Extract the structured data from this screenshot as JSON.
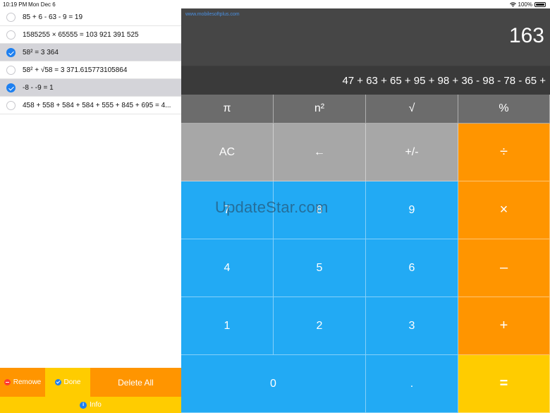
{
  "status": {
    "time": "10:19 PM",
    "date": "Mon Dec 6",
    "battery": "100%"
  },
  "history": [
    {
      "text": "85 + 6 - 63 - 9 = 19",
      "selected": false
    },
    {
      "text": "1585255 × 65555 = 103 921 391 525",
      "selected": false
    },
    {
      "text": "58² = 3 364",
      "selected": true
    },
    {
      "text": "58² + √58 = 3 371.615773105864",
      "selected": false
    },
    {
      "text": "-8 - -9 = 1",
      "selected": true
    },
    {
      "text": "458 + 558 + 584 + 584 + 555 + 845 + 695 = 4...",
      "selected": false
    }
  ],
  "actions": {
    "remove": "Remowe",
    "done": "Done",
    "delete_all": "Delete All",
    "info": "Info"
  },
  "display": {
    "site": "www.mobilesoftplus.com",
    "result": "163",
    "expression": "47 + 63 + 65 + 95 + 98 + 36 - 98 - 78 - 65 +"
  },
  "keys": {
    "pi": "π",
    "square": "n²",
    "sqrt": "√",
    "percent": "%",
    "clear": "AC",
    "backspace": "←",
    "sign": "+/-",
    "divide": "÷",
    "d7": "7",
    "d8": "8",
    "d9": "9",
    "multiply": "×",
    "d4": "4",
    "d5": "5",
    "d6": "6",
    "minus": "–",
    "d1": "1",
    "d2": "2",
    "d3": "3",
    "plus": "+",
    "d0": "0",
    "dot": ".",
    "equals": "="
  },
  "watermark": "UpdateStar.com",
  "colors": {
    "fn": "#6c6c6c",
    "gray": "#a7a7a7",
    "blue": "#22aaf4",
    "orange": "#ff9500",
    "yellow": "#ffcc00"
  }
}
